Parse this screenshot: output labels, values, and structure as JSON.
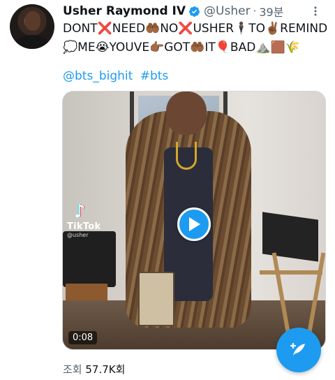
{
  "author": {
    "display_name": "Usher Raymond IV",
    "handle": "@Usher",
    "separator": "·",
    "timestamp": "39분",
    "verified_icon": "verified-badge-icon"
  },
  "tweet": {
    "text": "DONT❌NEED🤲🏾NO❌USHER🕴🏾TO✌🏾REMIND💭ME😭YOUVE👉🏾GOT🤲🏾IT🎈BAD⛰️🟫🌾",
    "hashtags": [
      "@bts_bighit",
      "#bts"
    ]
  },
  "media": {
    "tiktok_label": "TikTok",
    "tiktok_user": "@usher",
    "duration": "0:08",
    "play_icon": "play-icon"
  },
  "stats": {
    "views_label": "조회",
    "views_count": "57.7K회"
  },
  "colors": {
    "accent": "#1d9bf0",
    "text": "#0f1419",
    "secondary": "#536471"
  },
  "compose_icon": "compose-tweet-icon",
  "more_icon": "more-options-icon"
}
